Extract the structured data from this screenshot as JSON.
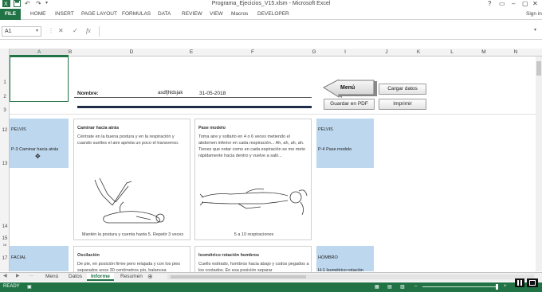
{
  "window": {
    "title": "Programa_Ejecicios_V15.xlsm - Microsoft Excel",
    "help": "?",
    "signin": "Sign in"
  },
  "ribbon": {
    "tabs": [
      "FILE",
      "HOME",
      "INSERT",
      "PAGE LAYOUT",
      "FORMULAS",
      "DATA",
      "REVIEW",
      "VIEW",
      "Macros",
      "DEVELOPER"
    ]
  },
  "formula_bar": {
    "name_box": "A1",
    "fx": "fx",
    "value": ""
  },
  "columns": [
    "A",
    "B",
    "D",
    "E",
    "F",
    "G",
    "I",
    "J",
    "K",
    "L",
    "M",
    "N"
  ],
  "rows": [
    "1",
    "2",
    "3",
    "12",
    "13",
    "14",
    "15",
    "16",
    "17"
  ],
  "header": {
    "nombre_label": "Nombre:",
    "nombre_value": "asdfjhldsjak",
    "date": "31-05-2018"
  },
  "buttons": {
    "menu": "Menú",
    "cargar": "Cargar datos",
    "guardar": "Guardar en PDF",
    "imprimir": "Imprimir"
  },
  "sections": [
    {
      "area": "PELVIS",
      "code": "P-3 Caminar hacia atrás"
    },
    {
      "area": "PELVIS",
      "code": "P-4 Pase modelo"
    },
    {
      "area": "FACIAL",
      "code": ""
    },
    {
      "area": "HOMBRO",
      "code": "H-1 Isométrico rotación"
    }
  ],
  "cards": [
    {
      "title": "Caminar hacia atrás",
      "text": "Céntrate en la buena postura y en la respiración y cuando sueltes el aire aprieta un poco el transverso.",
      "footer": "Mantén la postura y cuenta hasta 5. Repetir 3 veces"
    },
    {
      "title": "Pase modelo",
      "text": "Toma aire y soltarlo en 4 o 6 veces metiendo el abdomen inferior en cada respiración... Ah, ah, ah, ah. Tienes que notar como en cada espiración se me mete rápidamente hacia dentro y vuelve a salir...",
      "footer": "5 a 10 respiraciones"
    },
    {
      "title": "Oscilación",
      "text": "De pie, en posición firme pero relajada y con los pies separados unos 30 centímetros pío, balancea"
    },
    {
      "title": "Isométrico rotación hombros",
      "text": "Cuello estirado, hombros hacia abajo y codos pegados a los costados. En esa posición separar"
    }
  ],
  "sheet_tabs": [
    "Menú",
    "Datos",
    "Informe",
    "Resumen"
  ],
  "active_sheet": "Informe",
  "status": {
    "ready": "READY"
  }
}
